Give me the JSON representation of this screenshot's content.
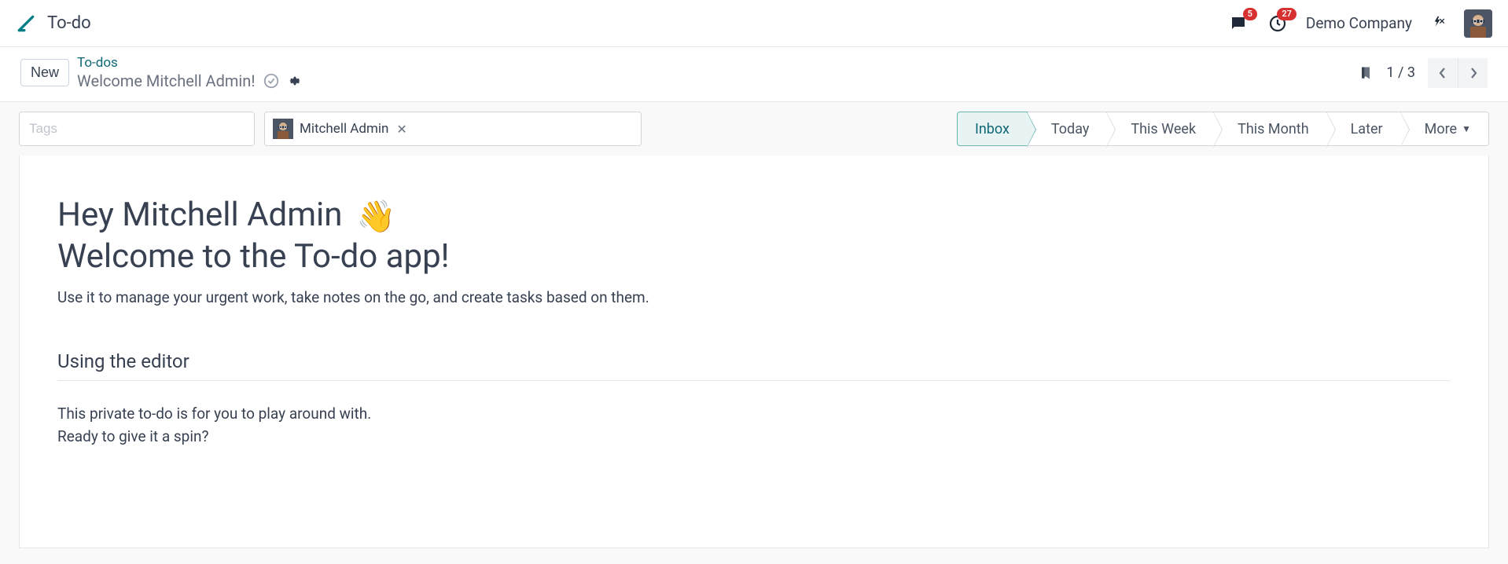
{
  "header": {
    "app_title": "To-do",
    "company": "Demo Company",
    "messages_badge": "5",
    "activities_badge": "27"
  },
  "breadcrumb": {
    "new_button": "New",
    "parent": "To-dos",
    "title": "Welcome Mitchell Admin!",
    "pager": "1 / 3"
  },
  "filters": {
    "tags_placeholder": "Tags",
    "assignee": {
      "name": "Mitchell Admin"
    }
  },
  "stages": {
    "items": [
      {
        "label": "Inbox",
        "active": true
      },
      {
        "label": "Today",
        "active": false
      },
      {
        "label": "This Week",
        "active": false
      },
      {
        "label": "This Month",
        "active": false
      },
      {
        "label": "Later",
        "active": false
      },
      {
        "label": "More",
        "active": false,
        "more": true
      }
    ]
  },
  "content": {
    "greeting_line1": "Hey Mitchell Admin",
    "greeting_emoji": "👋",
    "greeting_line2": "Welcome to the To-do app!",
    "intro": "Use it to manage your urgent work, take notes on the go, and create tasks based on them.",
    "section_title": "Using the editor",
    "body_line1": "This private to-do is for you to play around with.",
    "body_line2": "Ready to give it a spin?"
  }
}
